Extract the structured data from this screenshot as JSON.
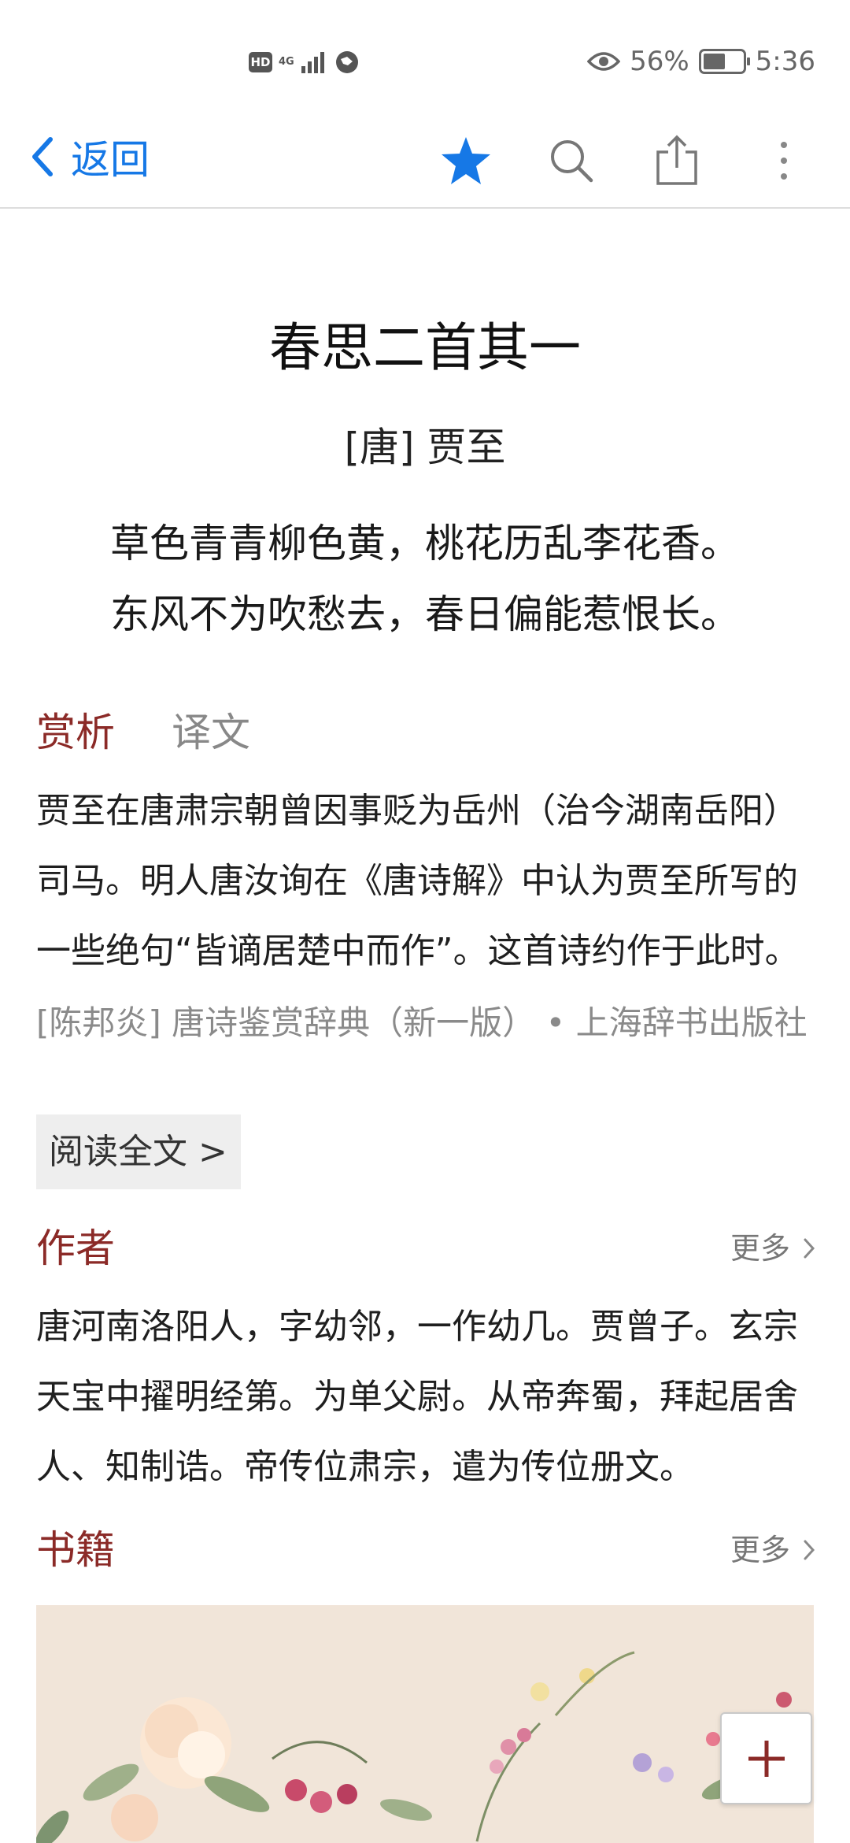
{
  "status_bar": {
    "hd": "HD",
    "network": "4G",
    "battery_percent": "56%",
    "battery_level": 0.56,
    "time": "5:36",
    "icons": [
      "hd-icon",
      "signal-icon",
      "data-icon",
      "eye-icon",
      "battery-icon"
    ]
  },
  "nav": {
    "back_label": "返回",
    "icons": [
      "back-chevron-icon",
      "star-icon",
      "search-icon",
      "share-icon",
      "more-vertical-icon"
    ],
    "accent_color": "#1678e6"
  },
  "poem": {
    "title": "春思二首其一",
    "author": "[唐] 贾至",
    "lines": [
      "草色青青柳色黄，桃花历乱李花香。",
      "东风不为吹愁去，春日偏能惹恨长。"
    ]
  },
  "tabs": {
    "appreciation": "赏析",
    "translation": "译文",
    "active_color": "#8b2a27"
  },
  "appreciation": {
    "text": "贾至在唐肃宗朝曾因事贬为岳州（治今湖南岳阳）司马。明人唐汝询在《唐诗解》中认为贾至所写的一些绝句“皆谪居楚中而作”。这首诗约作于此时。",
    "source": "[陈邦炎] 唐诗鉴赏辞典（新一版） • 上海辞书出版社",
    "read_full": "阅读全文 >"
  },
  "author_section": {
    "title": "作者",
    "more": "更多",
    "text": "唐河南洛阳人，字幼邻，一作幼几。贾曾子。玄宗天宝中擢明经第。为单父尉。从帝奔蜀，拜起居舍人、知制诰。帝传位肃宗，遣为传位册文。"
  },
  "books_section": {
    "title": "书籍",
    "more": "更多"
  },
  "fab": {
    "icon": "plus-icon",
    "color": "#8b2a27"
  }
}
